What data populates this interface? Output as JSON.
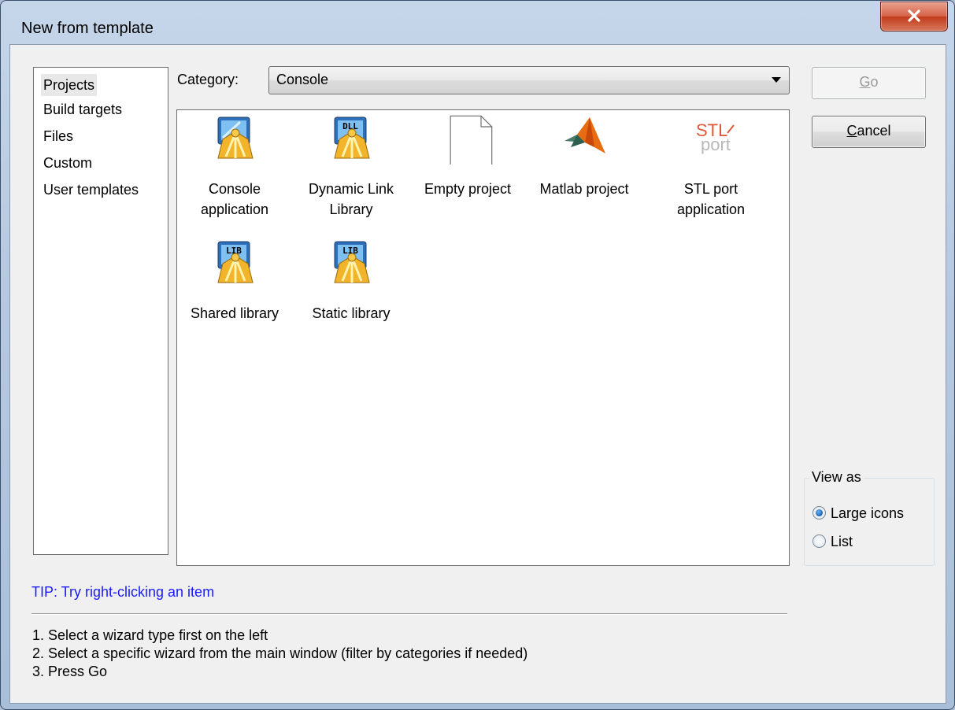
{
  "window": {
    "title": "New from template"
  },
  "sidebar": {
    "items": [
      {
        "label": "Projects",
        "selected": true
      },
      {
        "label": "Build targets",
        "selected": false
      },
      {
        "label": "Files",
        "selected": false
      },
      {
        "label": "Custom",
        "selected": false
      },
      {
        "label": "User templates",
        "selected": false
      }
    ]
  },
  "category": {
    "label": "Category:",
    "value": "Console"
  },
  "templates": [
    {
      "label": "Console application",
      "icon": "console-app-icon"
    },
    {
      "label": "Dynamic Link Library",
      "icon": "dll-icon",
      "badge": "DLL"
    },
    {
      "label": "Empty project",
      "icon": "blank-document-icon"
    },
    {
      "label": "Matlab project",
      "icon": "matlab-icon"
    },
    {
      "label": "STL port application",
      "icon": "stlport-icon",
      "logo_text": "STL port"
    },
    {
      "label": "Shared library",
      "icon": "lib-icon",
      "badge": "LIB"
    },
    {
      "label": "Static library",
      "icon": "lib-icon",
      "badge": "LIB"
    }
  ],
  "buttons": {
    "go": {
      "label": "Go",
      "mnemonic": "G",
      "enabled": false
    },
    "cancel": {
      "label": "Cancel",
      "mnemonic": "C",
      "enabled": true
    }
  },
  "view_as": {
    "title": "View as",
    "options": [
      {
        "label": "Large icons",
        "checked": true
      },
      {
        "label": "List",
        "checked": false
      }
    ]
  },
  "tip": "TIP: Try right-clicking an item",
  "instructions": [
    "1. Select a wizard type first on the left",
    "2. Select a specific wizard from the main window (filter by categories if needed)",
    "3. Press Go"
  ],
  "colors": {
    "tip_text": "#1a1aff",
    "close_button": "#c8452a",
    "selection": "#e8e8e8"
  }
}
